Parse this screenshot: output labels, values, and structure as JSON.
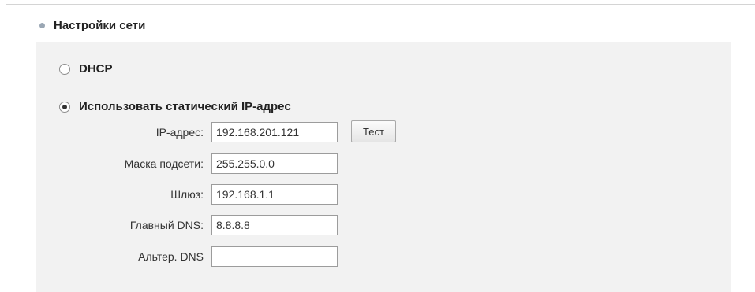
{
  "section": {
    "title": "Настройки сети"
  },
  "mode": {
    "dhcp_label": "DHCP",
    "static_label": "Использовать статический IP-адрес",
    "selected": "static"
  },
  "fields": {
    "ip": {
      "label": "IP-адрес:",
      "value": "192.168.201.121"
    },
    "mask": {
      "label": "Маска подсети:",
      "value": "255.255.0.0"
    },
    "gateway": {
      "label": "Шлюз:",
      "value": "192.168.1.1"
    },
    "dns_primary": {
      "label": "Главный DNS:",
      "value": "8.8.8.8"
    },
    "dns_alt": {
      "label": "Альтер. DNS",
      "value": ""
    }
  },
  "buttons": {
    "test_label": "Тест"
  }
}
